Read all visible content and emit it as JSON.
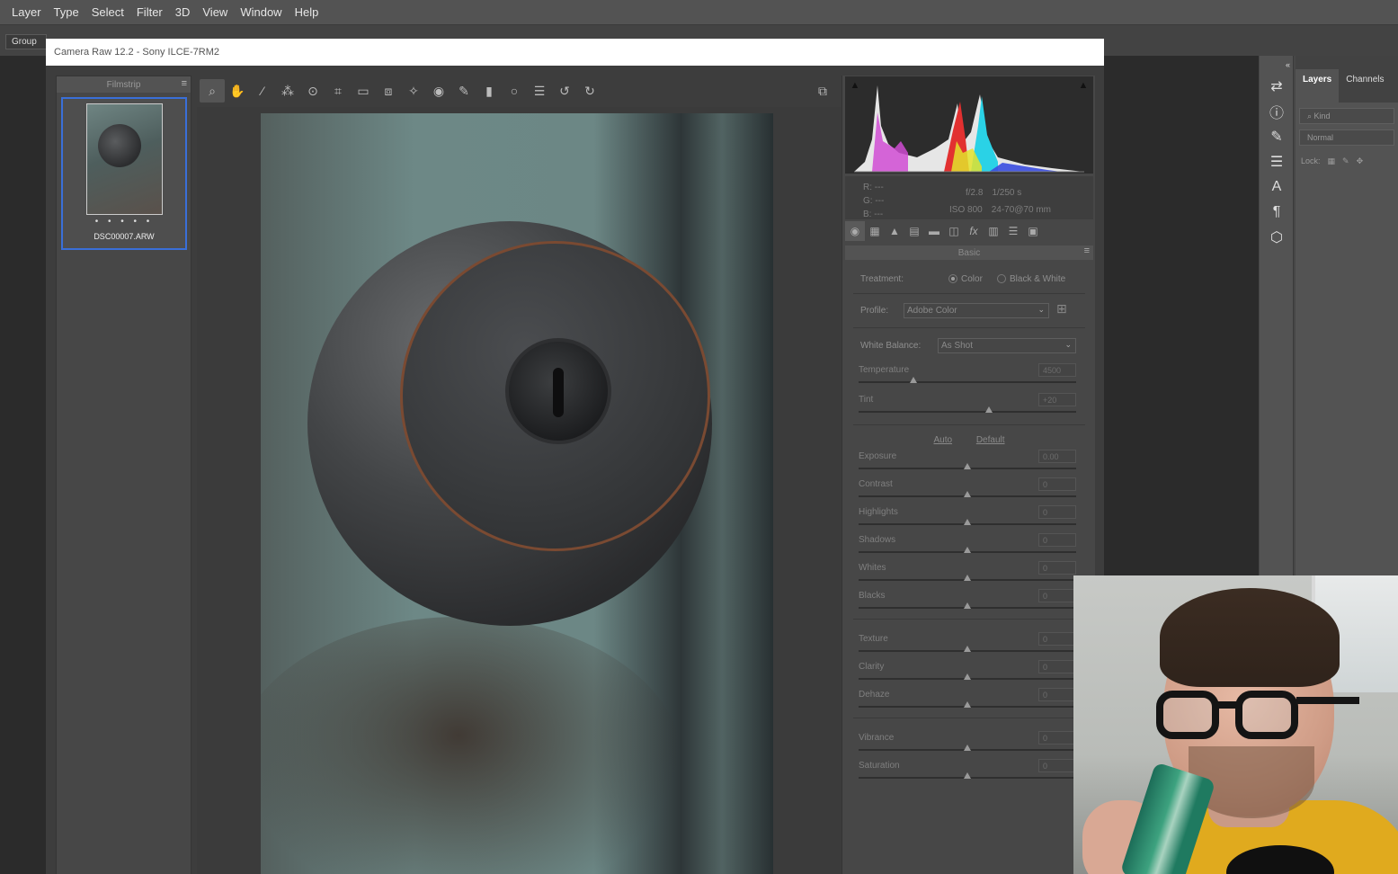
{
  "menubar": {
    "items": [
      "Layer",
      "Type",
      "Select",
      "Filter",
      "3D",
      "View",
      "Window",
      "Help"
    ]
  },
  "optionsbar": {
    "group_label": "Group"
  },
  "ps_panels": {
    "tabs": [
      "Layers",
      "Channels"
    ],
    "kind_placeholder": "Kind",
    "blend_mode": "Normal",
    "lock_label": "Lock:"
  },
  "camera_raw": {
    "title": "Camera Raw 12.2  -  Sony ILCE-7RM2",
    "filmstrip": {
      "header": "Filmstrip",
      "thumb_name": "DSC00007.ARW",
      "thumb_rating": "• • • • •"
    },
    "readout": {
      "r": "R:   ---",
      "g": "G:   ---",
      "b": "B:   ---",
      "aperture": "f/2.8",
      "shutter": "1/250 s",
      "iso": "ISO 800",
      "lens": "24-70@70 mm"
    },
    "section_title": "Basic",
    "treatment": {
      "label": "Treatment:",
      "color": "Color",
      "bw": "Black & White",
      "selected": "Color"
    },
    "profile": {
      "label": "Profile:",
      "value": "Adobe Color"
    },
    "white_balance": {
      "label": "White Balance:",
      "value": "As Shot"
    },
    "links": {
      "auto": "Auto",
      "default": "Default"
    },
    "sliders": [
      {
        "name": "Temperature",
        "value": "4500",
        "pos": 0.25
      },
      {
        "name": "Tint",
        "value": "+20",
        "pos": 0.6
      },
      {
        "name": "Exposure",
        "value": "0.00",
        "pos": 0.5
      },
      {
        "name": "Contrast",
        "value": "0",
        "pos": 0.5
      },
      {
        "name": "Highlights",
        "value": "0",
        "pos": 0.5
      },
      {
        "name": "Shadows",
        "value": "0",
        "pos": 0.5
      },
      {
        "name": "Whites",
        "value": "0",
        "pos": 0.5
      },
      {
        "name": "Blacks",
        "value": "0",
        "pos": 0.5
      },
      {
        "name": "Texture",
        "value": "0",
        "pos": 0.5
      },
      {
        "name": "Clarity",
        "value": "0",
        "pos": 0.5
      },
      {
        "name": "Dehaze",
        "value": "0",
        "pos": 0.5
      },
      {
        "name": "Vibrance",
        "value": "0",
        "pos": 0.5
      },
      {
        "name": "Saturation",
        "value": "0",
        "pos": 0.5
      }
    ]
  },
  "colors": {
    "accent": "#3a6fd8",
    "panel": "#474747",
    "menubar": "#535353"
  }
}
